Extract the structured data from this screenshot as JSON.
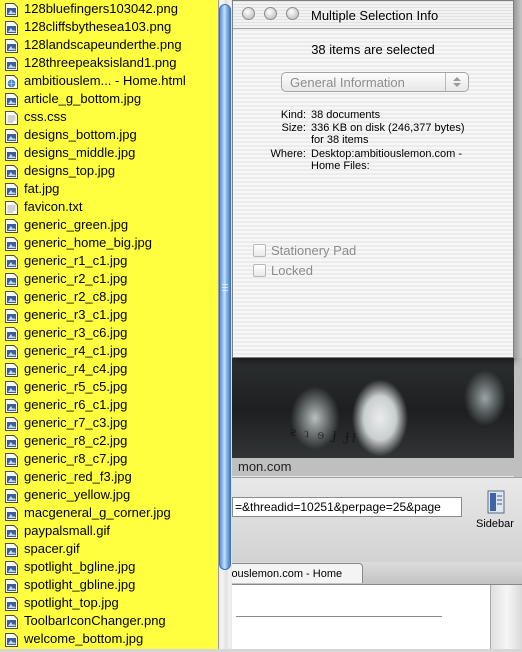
{
  "files": [
    {
      "name": "128bluefingers103042.png",
      "kind": "image"
    },
    {
      "name": "128cliffsbythesea103.png",
      "kind": "image"
    },
    {
      "name": "128landscapeunderthe.png",
      "kind": "image"
    },
    {
      "name": "128threepeaksisland1.png",
      "kind": "image"
    },
    {
      "name": "ambitiouslem... - Home.html",
      "kind": "html"
    },
    {
      "name": "article_g_bottom.jpg",
      "kind": "image"
    },
    {
      "name": "css.css",
      "kind": "text"
    },
    {
      "name": "designs_bottom.jpg",
      "kind": "image"
    },
    {
      "name": "designs_middle.jpg",
      "kind": "image"
    },
    {
      "name": "designs_top.jpg",
      "kind": "image"
    },
    {
      "name": "fat.jpg",
      "kind": "image"
    },
    {
      "name": "favicon.txt",
      "kind": "text"
    },
    {
      "name": "generic_green.jpg",
      "kind": "image"
    },
    {
      "name": "generic_home_big.jpg",
      "kind": "image"
    },
    {
      "name": "generic_r1_c1.jpg",
      "kind": "image"
    },
    {
      "name": "generic_r2_c1.jpg",
      "kind": "image"
    },
    {
      "name": "generic_r2_c8.jpg",
      "kind": "image"
    },
    {
      "name": "generic_r3_c1.jpg",
      "kind": "image"
    },
    {
      "name": "generic_r3_c6.jpg",
      "kind": "image"
    },
    {
      "name": "generic_r4_c1.jpg",
      "kind": "image"
    },
    {
      "name": "generic_r4_c4.jpg",
      "kind": "image"
    },
    {
      "name": "generic_r5_c5.jpg",
      "kind": "image"
    },
    {
      "name": "generic_r6_c1.jpg",
      "kind": "image"
    },
    {
      "name": "generic_r7_c3.jpg",
      "kind": "image"
    },
    {
      "name": "generic_r8_c2.jpg",
      "kind": "image"
    },
    {
      "name": "generic_r8_c7.jpg",
      "kind": "image"
    },
    {
      "name": "generic_red_f3.jpg",
      "kind": "image"
    },
    {
      "name": "generic_yellow.jpg",
      "kind": "image"
    },
    {
      "name": "macgeneral_g_corner.jpg",
      "kind": "image"
    },
    {
      "name": "paypalsmall.gif",
      "kind": "image"
    },
    {
      "name": "spacer.gif",
      "kind": "image"
    },
    {
      "name": "spotlight_bgline.jpg",
      "kind": "image"
    },
    {
      "name": "spotlight_gbline.jpg",
      "kind": "image"
    },
    {
      "name": "spotlight_top.jpg",
      "kind": "image"
    },
    {
      "name": "ToolbarIconChanger.png",
      "kind": "image"
    },
    {
      "name": "welcome_bottom.jpg",
      "kind": "image"
    }
  ],
  "info_window": {
    "title": "Multiple Selection Info",
    "selection_count": "38 items are selected",
    "panel_popup": "General Information",
    "kind_label": "Kind:",
    "kind_value": "38 documents",
    "size_label": "Size:",
    "size_value": "336 KB on disk (246,377 bytes)",
    "size_value_2": "for 38 items",
    "where_label": "Where:",
    "where_value": "Desktop:ambitiouslemon.com -",
    "where_value_2": "Home Files:",
    "stationery_label": "Stationery Pad",
    "locked_label": "Locked"
  },
  "browser": {
    "domain_text": "mon.com",
    "url_text": "=&threadid=10251&perpage=25&page",
    "sidebar_label": "Sidebar",
    "tab_label": "iouslemon.com - Home"
  },
  "colors": {
    "file_panel_bg": "#ffff40",
    "scroll_thumb": "#7fb0ea"
  }
}
